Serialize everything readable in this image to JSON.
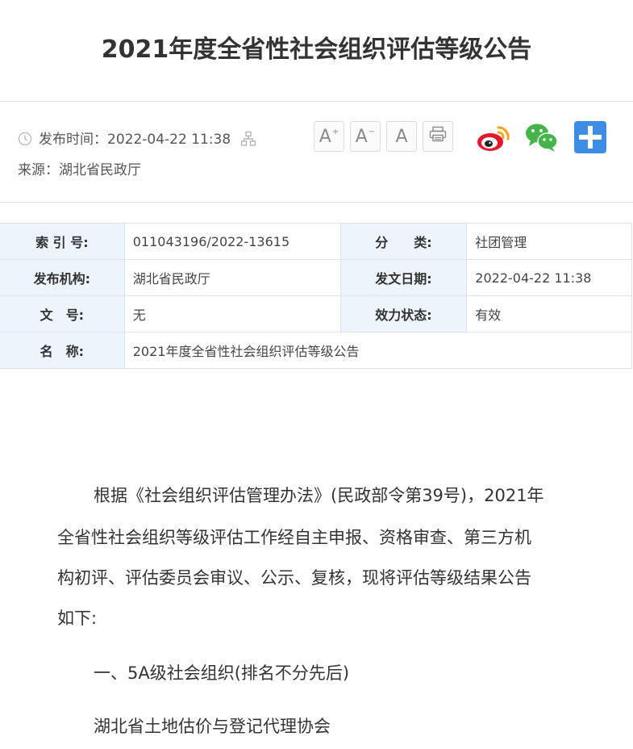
{
  "title": "2021年度全省性社会组织评估等级公告",
  "meta": {
    "publish_label": "发布时间：",
    "publish_time": "2022-04-22 11:38",
    "source_label": "来源：",
    "source": "湖北省民政厅"
  },
  "toolbar": {
    "font_increase": "A",
    "font_decrease": "A",
    "font_default": "A",
    "print_icon": "printer-icon",
    "share_icons": [
      "weibo-icon",
      "wechat-icon",
      "plus-share-icon"
    ]
  },
  "info_table": {
    "index_label": "索 引 号:",
    "index_value": "011043196/2022-13615",
    "category_label": "分　　类:",
    "category_value": "社团管理",
    "org_label": "发布机构:",
    "org_value": "湖北省民政厅",
    "date_label": "发文日期:",
    "date_value": "2022-04-22 11:38",
    "docno_label": "文　号:",
    "docno_value": "无",
    "status_label": "效力状态:",
    "status_value": "有效",
    "name_label": "名　称:",
    "name_value": "2021年度全省性社会组织评估等级公告"
  },
  "body": {
    "lines": [
      "根据《社会组织评估管理办法》(民政部令第39号)，2021年",
      "全省性社会组织等级评估工作经自主申报、资格审查、第三方机",
      "构初评、评估委员会审议、公示、复核，现将评估等级结果公告",
      "如下:"
    ],
    "section_heading": "一、5A级社会组织(排名不分先后)",
    "first_org": "湖北省土地估价与登记代理协会"
  },
  "colors": {
    "label_bg": "#edf4fc",
    "border": "#dde3ec",
    "weibo": "#e6162d",
    "wechat": "#44b549",
    "plus": "#3d8de5"
  }
}
